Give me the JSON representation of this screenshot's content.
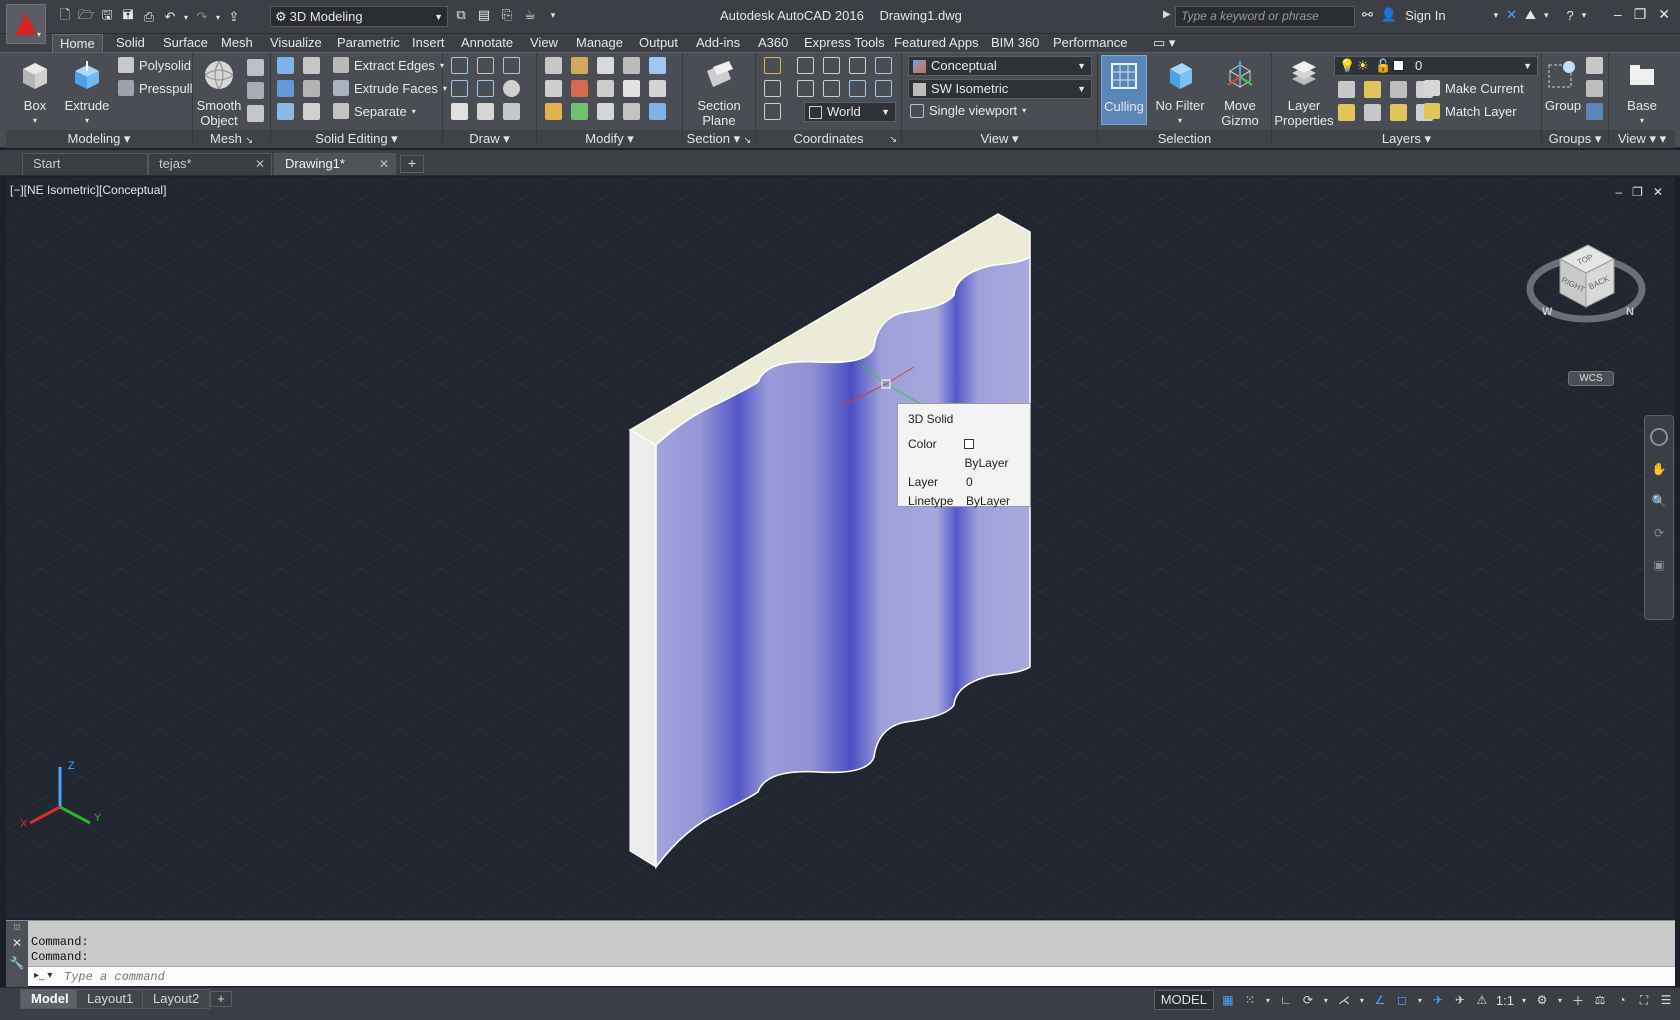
{
  "titlebar": {
    "workspace": "3D Modeling",
    "app_name": "Autodesk AutoCAD 2016",
    "document": "Drawing1.dwg",
    "search_placeholder": "Type a keyword or phrase",
    "sign_in": "Sign In"
  },
  "ribbon_tabs": [
    "Home",
    "Solid",
    "Surface",
    "Mesh",
    "Visualize",
    "Parametric",
    "Insert",
    "Annotate",
    "View",
    "Manage",
    "Output",
    "Add-ins",
    "A360",
    "Express Tools",
    "Featured Apps",
    "BIM 360",
    "Performance"
  ],
  "ribbon": {
    "modeling": {
      "title": "Modeling",
      "box": "Box",
      "extrude": "Extrude",
      "polysolid": "Polysolid",
      "presspull": "Presspull"
    },
    "mesh": {
      "title": "Mesh",
      "smooth_object_1": "Smooth",
      "smooth_object_2": "Object"
    },
    "solid_editing": {
      "title": "Solid Editing",
      "extract_edges": "Extract Edges",
      "extrude_faces": "Extrude Faces",
      "separate": "Separate"
    },
    "draw": {
      "title": "Draw"
    },
    "modify": {
      "title": "Modify"
    },
    "section": {
      "title": "Section",
      "section_plane_1": "Section",
      "section_plane_2": "Plane"
    },
    "coordinates": {
      "title": "Coordinates",
      "world": "World"
    },
    "view": {
      "title": "View",
      "visual_style": "Conceptual",
      "view_direction": "SW Isometric",
      "viewport_config": "Single viewport"
    },
    "selection": {
      "title": "Selection",
      "culling": "Culling",
      "no_filter": "No Filter",
      "move_gizmo_1": "Move",
      "move_gizmo_2": "Gizmo"
    },
    "layers": {
      "title": "Layers",
      "layer_properties_1": "Layer",
      "layer_properties_2": "Properties",
      "current_layer": "0",
      "make_current": "Make Current",
      "match_layer": "Match Layer"
    },
    "groups": {
      "title": "Groups",
      "group": "Group"
    },
    "view2": {
      "title": "View",
      "base": "Base"
    }
  },
  "file_tabs": [
    {
      "label": "Start"
    },
    {
      "label": "tejas*"
    },
    {
      "label": "Drawing1*"
    }
  ],
  "viewport": {
    "label": "[−][NE Isometric][Conceptual]",
    "viewcube_top": "TOP",
    "viewcube_right": "RIGHT",
    "viewcube_back": "BACK",
    "compass_w": "W",
    "compass_n": "N",
    "wcs": "WCS",
    "ucs_x": "X",
    "ucs_y": "Y",
    "ucs_z": "Z"
  },
  "tooltip": {
    "title": "3D Solid",
    "rows": [
      {
        "key": "Color",
        "value": "ByLayer"
      },
      {
        "key": "Layer",
        "value": "0"
      },
      {
        "key": "Linetype",
        "value": "ByLayer"
      }
    ]
  },
  "command": {
    "history": [
      "Command:",
      "Command:"
    ],
    "placeholder": "Type a command"
  },
  "layout_tabs": [
    "Model",
    "Layout1",
    "Layout2"
  ],
  "status": {
    "model": "MODEL",
    "scale": "1:1"
  },
  "colors": {
    "accent": "#d42320",
    "solid_face": "#8f92d6",
    "solid_top": "#ededd8",
    "viewport_bg": "#212630"
  }
}
